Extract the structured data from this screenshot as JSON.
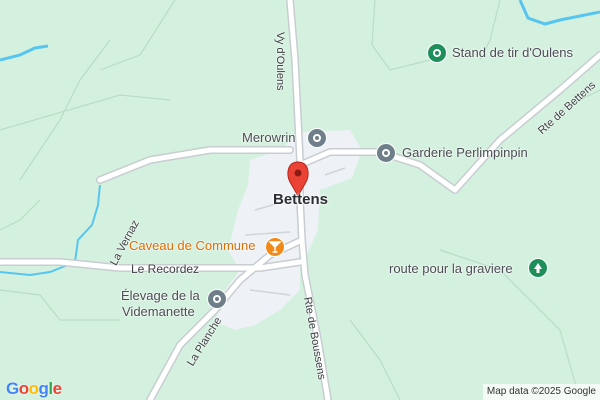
{
  "map": {
    "town_label": "Bettens",
    "poi": {
      "stand_de_tir": "Stand de tir d'Oulens",
      "merowrin": "Merowrin",
      "garderie": "Garderie Perlimpinpin",
      "caveau": "Caveau de Commune",
      "route_graviere": "route pour la graviere",
      "elevage_line1": "Élevage de la",
      "elevage_line2": "Videmanette"
    },
    "roads": {
      "vy_doulens": "Vy d'Oulens",
      "rte_de_bettens": "Rte de Bettens",
      "la_vernaz": "La Vernaz",
      "le_recordez": "Le Recordez",
      "rte_de_boussens": "Rte de Boussens",
      "la_planche": "La Planche"
    },
    "icons": {
      "pin": "red-location-pin-icon",
      "generic_poi": "circle-place-icon",
      "bar": "cocktail-glass-icon",
      "tree": "pine-tree-icon"
    },
    "colors": {
      "land": "#d4f0de",
      "water": "#56c6f0",
      "road": "#ffffff",
      "settlement": "#eef1f5",
      "pin": "#ea4335"
    }
  },
  "branding": {
    "logo": "Google",
    "attribution": "Map data ©2025 Google"
  }
}
